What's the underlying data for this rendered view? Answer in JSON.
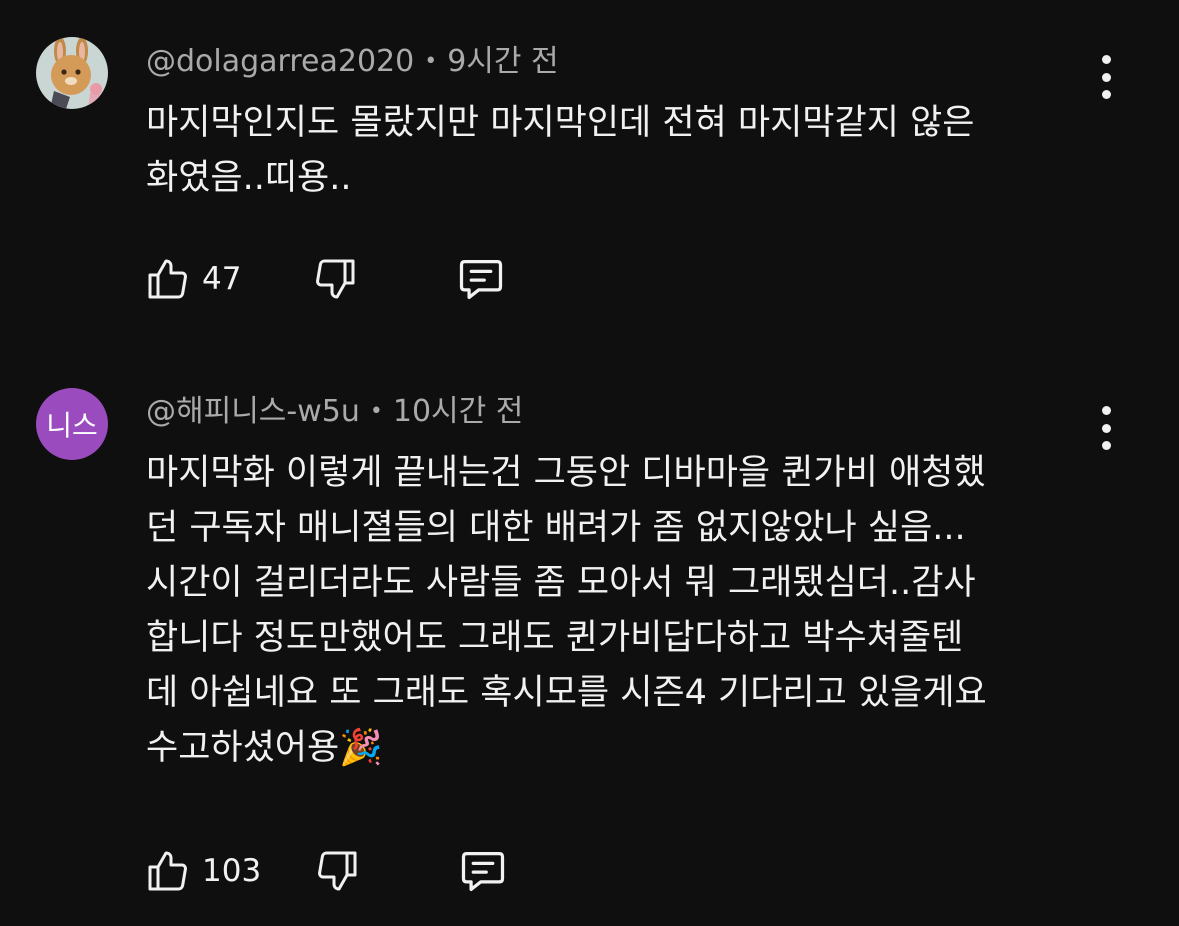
{
  "comments": [
    {
      "author": "@dolagarrea2020",
      "time": "9시간 전",
      "text": "마지막인지도 몰랐지만 마지막인데 전혀 마지막같지 않은\n화였음..띠용..",
      "likes": "47",
      "avatar": {
        "type": "image",
        "icon": "bunny-avatar-icon"
      }
    },
    {
      "author": "@해피니스-w5u",
      "time": "10시간 전",
      "text": "마지막화 이렇게 끝내는건 그동안 디바마을 퀸가비 애청했\n던 구독자 매니졀들의 대한 배려가 좀 없지않았나 싶음...\n시간이 걸리더라도 사람들 좀 모아서 뭐 그래됐심더..감사\n합니다 정도만했어도 그래도 퀸가비답다하고 박수쳐줄텐\n데 아쉽네요 또 그래도 혹시모를 시즌4 기다리고 있을게요\n수고하셨어용🎉",
      "likes": "103",
      "avatar": {
        "type": "initials",
        "initials": "니스",
        "color": "#9a4cbf"
      }
    }
  ],
  "separator": "•",
  "icons": {
    "like": "thumbs-up-icon",
    "dislike": "thumbs-down-icon",
    "reply": "reply-icon",
    "menu": "more-vert-icon"
  }
}
